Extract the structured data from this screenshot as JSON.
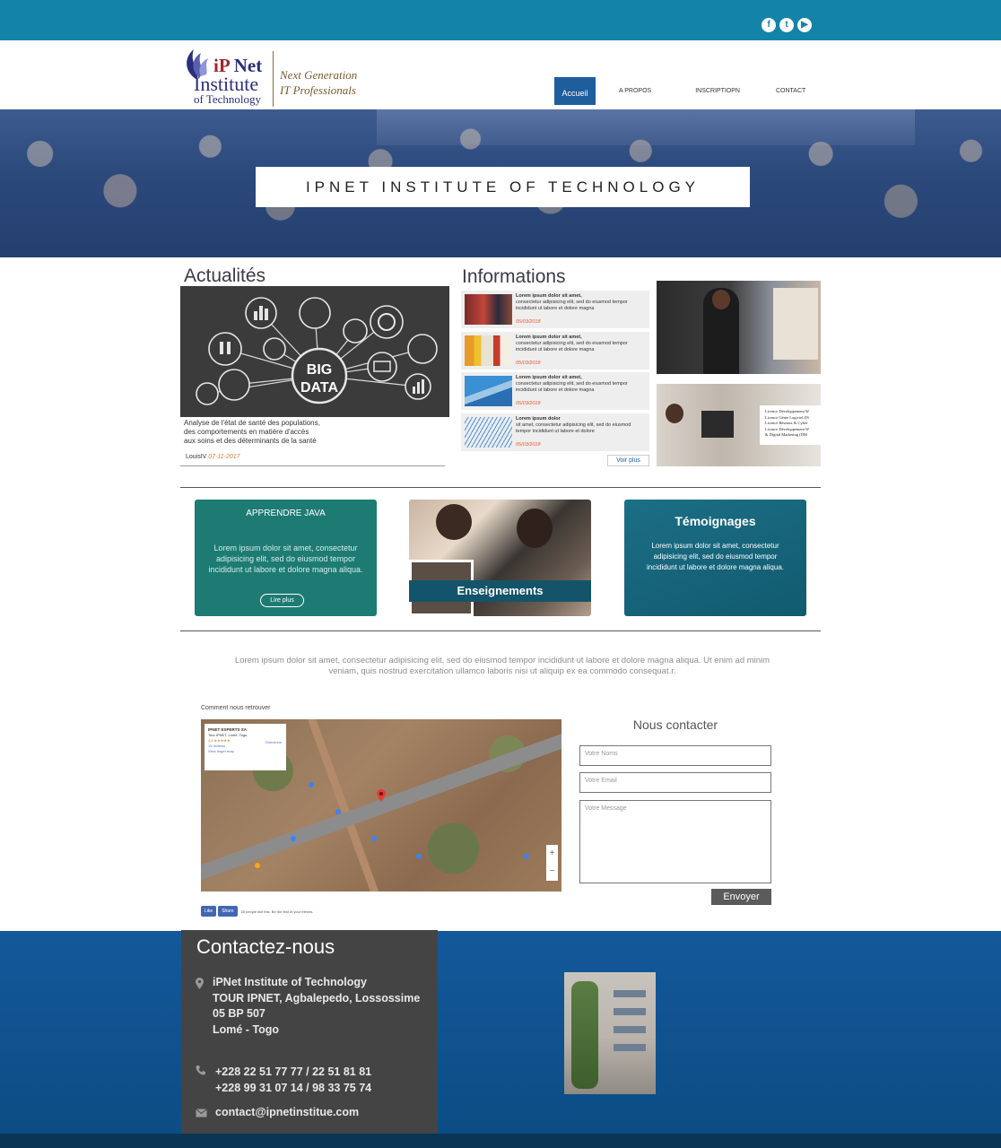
{
  "social": [
    {
      "icon": "facebook-icon",
      "glyph": "f"
    },
    {
      "icon": "twitter-icon",
      "glyph": "t"
    },
    {
      "icon": "youtube-icon",
      "glyph": "▶"
    }
  ],
  "logo": {
    "line1_a": "iP",
    "line1_b": " Net",
    "line2": "Institute",
    "line3": "of Technology",
    "tagline1": "Next Generation",
    "tagline2": "IT Professionals"
  },
  "nav": {
    "items": [
      "Accueil",
      "A PROPOS",
      "INSCRIPTIOPN",
      "CONTACT"
    ]
  },
  "hero": {
    "title": "IPNET INSTITUTE OF TECHNOLOGY"
  },
  "actualites": {
    "heading": "Actualités",
    "image_text1": "BIG",
    "image_text2": "DATA",
    "text": "Analyse de l'état de santé des populations,\ndes comportements en matière d'accès\naux soins et des déterminants de la santé",
    "author": "LouisIV ",
    "date": "07-11-2017"
  },
  "informations": {
    "heading": "Informations",
    "items": [
      {
        "title": "Lorem ipsum dolor sit amet,",
        "body": " consectetur adipisicing elit, sed do eiusmod tempor incididunt ut labore et dolore magna",
        "date": "05/03/2018"
      },
      {
        "title": "Lorem ipsum dolor sit amet,",
        "body": "consectetur adipisicing elit, sed do eiusmod tempor incididunt ut labore et dolore magna",
        "date": "05/03/2018"
      },
      {
        "title": "Lorem ipsum dolor sit amet,",
        "body": "consectetur adipisicing elit, sed do eiusmod tempor incididunt ut labore et dolore magna",
        "date": "05/03/2018"
      },
      {
        "title": "Lorem ipsum dolor",
        "body": "sit amet, consectetur adipisicing elit, sed do eiusmod tempor incididunt ut labore et dolore",
        "date": "05/03/2018"
      }
    ],
    "more": "Voir plus"
  },
  "licence_card": {
    "lines": [
      "Licence Développement W",
      "Licence Génie Logiciel (IS",
      "Licence Réseaux & Cyber",
      "Licence Développement W",
      "& Digital Marketing (DM"
    ]
  },
  "cards": {
    "java": {
      "title": "APPRENDRE JAVA",
      "text": "Lorem ipsum dolor sit amet, consectetur adipisicing elit, sed do eiusmod tempor incididunt ut labore et dolore magna aliqua.",
      "button": "Lire plus"
    },
    "enseignements": {
      "label": "Enseignements"
    },
    "temoignages": {
      "title": "Témoignages",
      "text": "Lorem ipsum dolor sit amet, consectetur adipisicing elit, sed do eiusmod tempor incididunt ut labore et dolore magna aliqua."
    }
  },
  "intro": "Lorem ipsum dolor sit amet, consectetur adipisicing elit, sed do eiusmod tempor incididunt ut labore et dolore magna aliqua. Ut enim ad minim veniam, quis nostrud exercitation ullamco laboris nisi ut aliquip ex ea commodo consequat.r.",
  "map": {
    "title": "Comment nous retrouver",
    "popup_name": "IPNET EXPERTS SA",
    "popup_addr": "Tour IPNET, Lomé, Togo",
    "popup_rating": "4.6 ★★★★★",
    "popup_reviews": "15 reviews",
    "popup_link": "View larger map",
    "popup_directions": "Directions",
    "zoom_in": "+",
    "zoom_out": "−"
  },
  "facebook": {
    "like": "Like",
    "share": "Share",
    "text": "26 people like this. Be the first of your friends."
  },
  "contact_form": {
    "heading": "Nous contacter",
    "name_placeholder": "Votre Noms",
    "email_placeholder": "Votre Email",
    "message_placeholder": "Votre Message",
    "send": "Envoyer"
  },
  "footer": {
    "heading": "Contactez-nous",
    "address": [
      "iPNet Institute of Technology",
      "TOUR IPNET, Agbalepedo, Lossossime",
      "05 BP 507",
      "Lomé - Togo"
    ],
    "phones": [
      "+228 22 51 77 77 / 22 51 81 81",
      "+228 99 31 07 14 / 98 33 75 74"
    ],
    "email": "contact@ipnetinstitue.com"
  },
  "colors": {
    "topbar": "#1483a8",
    "nav_active": "#1f5e9c",
    "footer": "#0a4c82",
    "accent_date": "#e17b2c"
  }
}
